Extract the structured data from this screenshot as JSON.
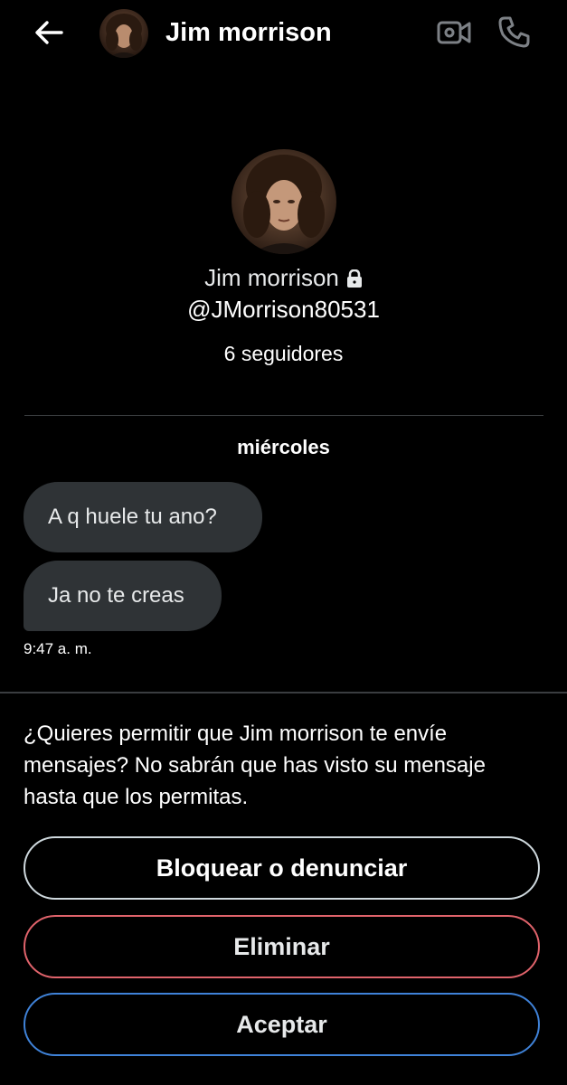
{
  "header": {
    "title": "Jim morrison",
    "back_icon": "arrow-left-icon",
    "video_icon": "video-camera-icon",
    "call_icon": "phone-icon"
  },
  "profile": {
    "name": "Jim morrison",
    "lock_icon": "lock-icon",
    "handle": "@JMorrison80531",
    "followers": "6 seguidores"
  },
  "conversation": {
    "day_label": "miércoles",
    "messages": [
      {
        "text": "A q huele tu ano?"
      },
      {
        "text": "Ja no te creas"
      }
    ],
    "timestamp": "9:47 a. m."
  },
  "request": {
    "prompt": "¿Quieres permitir que Jim morrison te envíe mensajes? No sabrán que has visto su mensaje hasta que los permitas.",
    "block_label": "Bloquear o denunciar",
    "delete_label": "Eliminar",
    "accept_label": "Aceptar"
  },
  "colors": {
    "background": "#000000",
    "bubble": "#2f3336",
    "delete_border": "#e0636b",
    "accept_border": "#3f82d8"
  }
}
